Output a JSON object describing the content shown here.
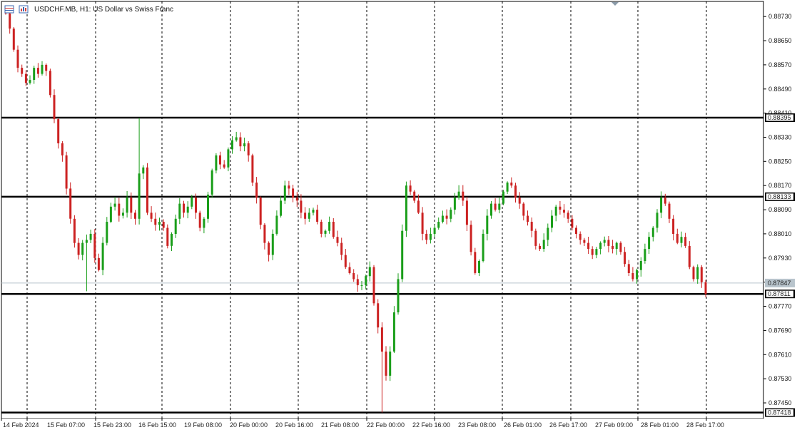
{
  "window": {
    "symbol_title": "USDCHF.MB, H1:  US Dollar vs Swiss Franc",
    "icons": [
      "chart-grid-icon",
      "chart-properties-icon",
      "scroll-marker-icon"
    ]
  },
  "colors": {
    "bull": "#1a9e1a",
    "bear": "#cc2222",
    "grid": "#000000",
    "level_line": "#000000",
    "current_price_line": "#b8c4cc",
    "background": "#ffffff"
  },
  "chart_data": {
    "type": "candlestick",
    "ylim": [
      0.87398,
      0.8878
    ],
    "y_ticks": [
      "0.88730",
      "0.88650",
      "0.88570",
      "0.88490",
      "0.88410",
      "0.88330",
      "0.88250",
      "0.88170",
      "0.88090",
      "0.88010",
      "0.87930",
      "0.87850",
      "0.87770",
      "0.87690",
      "0.87610",
      "0.87530",
      "0.87450"
    ],
    "x_labels": [
      "14 Feb 2024",
      "15 Feb 07:00",
      "15 Feb 23:00",
      "16 Feb 15:00",
      "19 Feb 08:00",
      "20 Feb 00:00",
      "20 Feb 16:00",
      "21 Feb 08:00",
      "22 Feb 00:00",
      "22 Feb 16:00",
      "23 Feb 08:00",
      "26 Feb 01:00",
      "26 Feb 17:00",
      "27 Feb 09:00",
      "28 Feb 01:00",
      "28 Feb 17:00"
    ],
    "levels": [
      {
        "label": "0.88395",
        "value": 0.88395
      },
      {
        "label": "0.88133",
        "value": 0.88133
      },
      {
        "label": "0.87811",
        "value": 0.87811
      },
      {
        "label": "0.87418",
        "value": 0.87418
      }
    ],
    "current_price": {
      "label": "0.87847",
      "value": 0.87847
    },
    "close_path": [
      0.8874,
      0.8869,
      0.8862,
      0.8856,
      0.8854,
      0.8851,
      0.8852,
      0.8856,
      0.8854,
      0.8857,
      0.8855,
      0.8847,
      0.8839,
      0.8831,
      0.8827,
      0.8816,
      0.8806,
      0.8798,
      0.8794,
      0.8798,
      0.8799,
      0.8801,
      0.8793,
      0.8789,
      0.8798,
      0.8805,
      0.881,
      0.8811,
      0.8807,
      0.8808,
      0.8813,
      0.8808,
      0.8806,
      0.8821,
      0.8823,
      0.8808,
      0.8806,
      0.8804,
      0.8805,
      0.8803,
      0.8797,
      0.8801,
      0.8806,
      0.8811,
      0.8808,
      0.881,
      0.8813,
      0.8808,
      0.8803,
      0.8806,
      0.8814,
      0.8822,
      0.8827,
      0.8824,
      0.8823,
      0.8829,
      0.8832,
      0.8833,
      0.883,
      0.8831,
      0.8827,
      0.8818,
      0.8813,
      0.8804,
      0.8798,
      0.8794,
      0.8801,
      0.8807,
      0.8812,
      0.8817,
      0.8816,
      0.8813,
      0.8812,
      0.8808,
      0.8806,
      0.8808,
      0.8809,
      0.8805,
      0.8801,
      0.8802,
      0.8805,
      0.88,
      0.8798,
      0.8794,
      0.879,
      0.8788,
      0.8786,
      0.8784,
      0.8784,
      0.8787,
      0.879,
      0.8778,
      0.877,
      0.8762,
      0.8754,
      0.8762,
      0.8775,
      0.8786,
      0.8802,
      0.8817,
      0.8815,
      0.8812,
      0.8808,
      0.8801,
      0.8799,
      0.8801,
      0.8803,
      0.8805,
      0.8807,
      0.8806,
      0.8809,
      0.8813,
      0.8815,
      0.8812,
      0.8804,
      0.8795,
      0.8788,
      0.8792,
      0.8801,
      0.8807,
      0.8811,
      0.8809,
      0.8811,
      0.8815,
      0.8818,
      0.8817,
      0.8813,
      0.8811,
      0.8807,
      0.8805,
      0.8802,
      0.8797,
      0.8796,
      0.8799,
      0.8803,
      0.8807,
      0.881,
      0.8809,
      0.8808,
      0.8806,
      0.8803,
      0.8801,
      0.8799,
      0.8798,
      0.8796,
      0.8794,
      0.8796,
      0.8798,
      0.8799,
      0.8797,
      0.8796,
      0.8798,
      0.8795,
      0.8791,
      0.8788,
      0.8786,
      0.8789,
      0.8792,
      0.8796,
      0.88,
      0.8803,
      0.8808,
      0.8813,
      0.8811,
      0.8806,
      0.8801,
      0.8798,
      0.88,
      0.8797,
      0.879,
      0.8786,
      0.879,
      0.8785,
      0.87811
    ]
  }
}
